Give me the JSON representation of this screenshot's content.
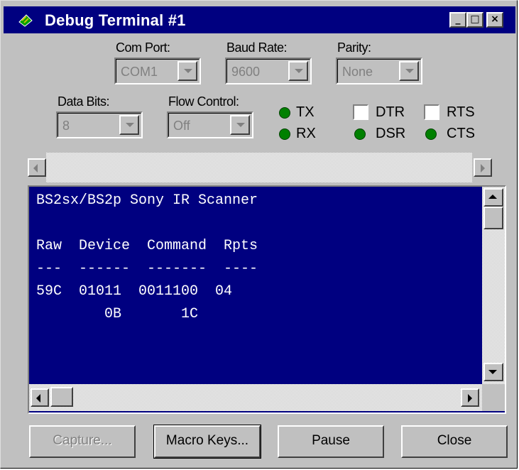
{
  "window": {
    "title": "Debug Terminal #1",
    "title_icon": "debug-terminal-icon",
    "controls": {
      "minimize": "_",
      "maximize": "□",
      "close": "×"
    }
  },
  "settings": {
    "com_port": {
      "label": "Com Port:",
      "value": "COM1"
    },
    "baud_rate": {
      "label": "Baud Rate:",
      "value": "9600"
    },
    "parity": {
      "label": "Parity:",
      "value": "None"
    },
    "data_bits": {
      "label": "Data Bits:",
      "value": "8"
    },
    "flow_control": {
      "label": "Flow Control:",
      "value": "Off"
    }
  },
  "indicators": {
    "tx": "TX",
    "rx": "RX",
    "dtr": "DTR",
    "rts": "RTS",
    "dsr": "DSR",
    "cts": "CTS",
    "led_color": "#008000"
  },
  "terminal": {
    "background": "#000080",
    "lines": [
      "BS2sx/BS2p Sony IR Scanner",
      "",
      "Raw  Device  Command  Rpts",
      "---  ------  -------  ----",
      "59C  01011  0011100  04",
      "        0B       1C"
    ]
  },
  "buttons": {
    "capture": "Capture...",
    "macro_keys": "Macro Keys...",
    "pause": "Pause",
    "close": "Close"
  }
}
